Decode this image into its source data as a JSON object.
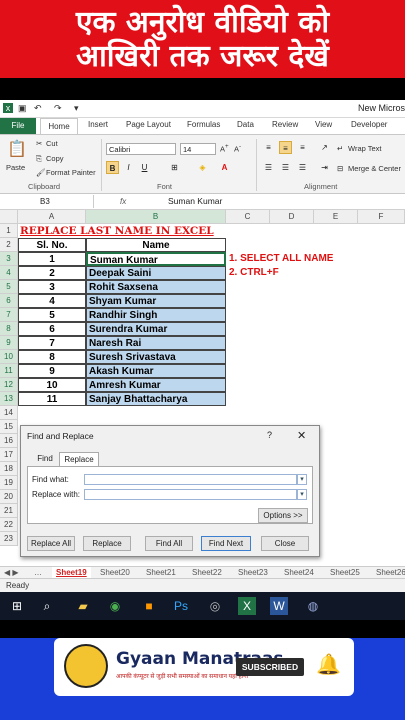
{
  "banner": {
    "line1": "एक अनुरोध वीडियो को",
    "line2": "आखिरी तक जरूर देखें"
  },
  "window": {
    "title": "New Micros"
  },
  "ribbon_tabs": {
    "file": "File",
    "home": "Home",
    "insert": "Insert",
    "page_layout": "Page Layout",
    "formulas": "Formulas",
    "data": "Data",
    "review": "Review",
    "view": "View",
    "developer": "Developer"
  },
  "clipboard": {
    "paste": "Paste",
    "cut": "Cut",
    "copy": "Copy",
    "format_painter": "Format Painter",
    "group": "Clipboard"
  },
  "font": {
    "name": "Calibri",
    "size": "14",
    "bold": "B",
    "italic": "I",
    "underline": "U",
    "group": "Font"
  },
  "alignment": {
    "wrap": "Wrap Text",
    "merge": "Merge & Center",
    "group": "Alignment"
  },
  "formula_bar": {
    "name_box": "B3",
    "fx": "fx",
    "value": "Suman Kumar"
  },
  "columns": [
    "A",
    "B",
    "C",
    "D",
    "E",
    "F"
  ],
  "rows": [
    "1",
    "2",
    "3",
    "4",
    "5",
    "6",
    "7",
    "8",
    "9",
    "10",
    "11",
    "12",
    "13",
    "14",
    "15",
    "16",
    "17",
    "18",
    "19",
    "20",
    "21",
    "22",
    "23"
  ],
  "sheet_title": "REPLACE LAST NAME IN EXCEL",
  "table_headers": {
    "slno": "Sl. No.",
    "name": "Name"
  },
  "table_rows": [
    {
      "no": "1",
      "name": "Suman Kumar"
    },
    {
      "no": "2",
      "name": "Deepak Saini"
    },
    {
      "no": "3",
      "name": "Rohit Saxsena"
    },
    {
      "no": "4",
      "name": "Shyam Kumar"
    },
    {
      "no": "5",
      "name": "Randhir Singh"
    },
    {
      "no": "6",
      "name": "Surendra Kumar"
    },
    {
      "no": "7",
      "name": "Naresh Rai"
    },
    {
      "no": "8",
      "name": "Suresh Srivastava"
    },
    {
      "no": "9",
      "name": "Akash Kumar"
    },
    {
      "no": "10",
      "name": "Amresh Kumar"
    },
    {
      "no": "11",
      "name": "Sanjay Bhattacharya"
    }
  ],
  "notes": [
    "1. SELECT ALL NAME",
    "2. CTRL+F"
  ],
  "dialog": {
    "title": "Find and Replace",
    "help": "?",
    "close": "✕",
    "tab_find": "Find",
    "tab_replace": "Replace",
    "find_label": "Find what:",
    "find_value": "",
    "replace_label": "Replace with:",
    "replace_value": "",
    "options": "Options >>",
    "replace_all": "Replace All",
    "replace": "Replace",
    "find_all": "Find All",
    "find_next": "Find Next",
    "close_btn": "Close"
  },
  "sheets": [
    "Sheet19",
    "Sheet20",
    "Sheet21",
    "Sheet22",
    "Sheet23",
    "Sheet24",
    "Sheet25",
    "Sheet26"
  ],
  "status": "Ready",
  "promo": {
    "brand": "Gyaan Manatraas",
    "tagline": "आपकी कंप्यूटर से जुड़ी सभी समस्याओं का समाधान यहां होगा",
    "subscribe": "SUBSCRIBED"
  },
  "colors": {
    "banner": "#e10f18",
    "excel_green": "#217346",
    "name_fill": "#bdd7ee",
    "note_red": "#e01010",
    "promo_blue": "#1a3ed8"
  }
}
